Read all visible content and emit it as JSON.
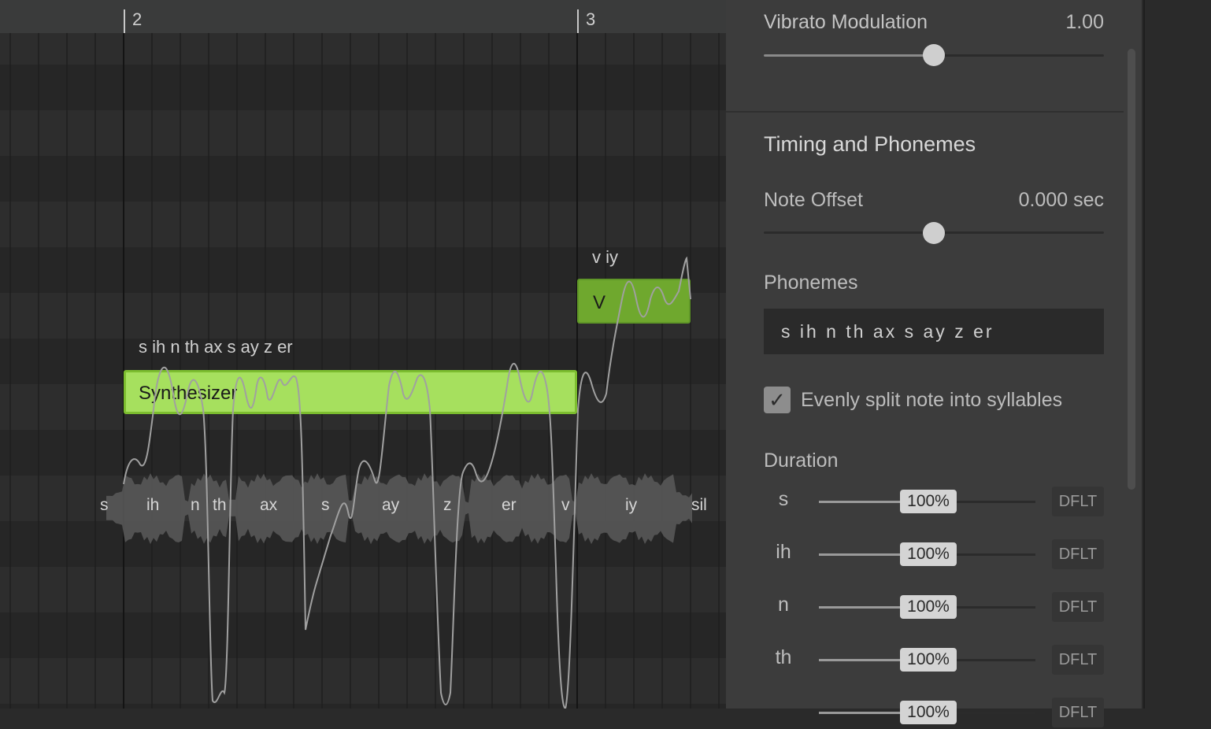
{
  "ruler": {
    "bar_2": "2",
    "bar_3": "3"
  },
  "notes": [
    {
      "lyric": "Synthesizer",
      "phonemes": "s ih n th ax s ay z er",
      "color": "#a6e05e"
    },
    {
      "lyric": "V",
      "phonemes": "v iy",
      "color": "#6fa82e"
    }
  ],
  "phoneme_track": [
    "s",
    "ih",
    "n",
    "th",
    "ax",
    "s",
    "ay",
    "z",
    "er",
    "v",
    "iy",
    "sil"
  ],
  "panel": {
    "vibrato_modulation": {
      "label": "Vibrato Modulation",
      "value": "1.00",
      "level": 0.5
    },
    "timing_section_title": "Timing and Phonemes",
    "note_offset": {
      "label": "Note Offset",
      "value": "0.000 sec",
      "level": 0.5
    },
    "phonemes": {
      "label": "Phonemes",
      "value": "s ih n th ax s ay z er"
    },
    "split_checkbox": {
      "label": "Evenly split note into syllables",
      "checked": true,
      "mark": "✓"
    },
    "duration": {
      "label": "Duration",
      "rows": [
        {
          "phoneme": "s",
          "value": "100%",
          "reset": "DFLT"
        },
        {
          "phoneme": "ih",
          "value": "100%",
          "reset": "DFLT"
        },
        {
          "phoneme": "n",
          "value": "100%",
          "reset": "DFLT"
        },
        {
          "phoneme": "th",
          "value": "100%",
          "reset": "DFLT"
        },
        {
          "phoneme": "",
          "value": "100%",
          "reset": "DFLT"
        }
      ]
    }
  }
}
